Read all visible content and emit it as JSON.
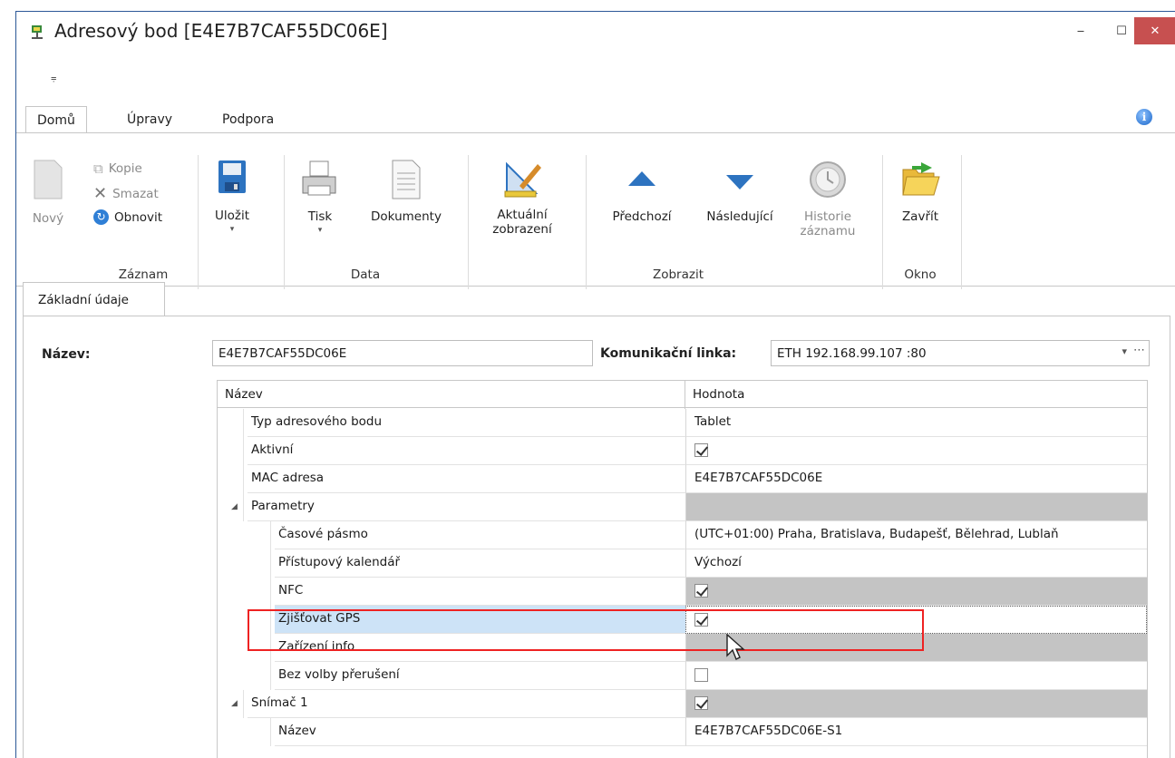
{
  "window": {
    "title": "Adresový bod [E4E7B7CAF55DC06E]",
    "min_glyph": "‒",
    "max_glyph": "☐",
    "close_glyph": "✕"
  },
  "qat": {
    "glyph": "⩦"
  },
  "ribbon_tabs": [
    "Domů",
    "Úpravy",
    "Podpora"
  ],
  "info_glyph": "i",
  "ribbon": {
    "record": {
      "new": "Nový",
      "copy": "Kopie",
      "delete": "Smazat",
      "refresh": "Obnovit",
      "group": "Záznam"
    },
    "data": {
      "save": "Uložit",
      "print": "Tisk",
      "documents": "Dokumenty",
      "group": "Data"
    },
    "view": {
      "current_line1": "Aktuální",
      "current_line2": "zobrazení",
      "prev": "Předchozí",
      "next": "Následující",
      "history_line1": "Historie",
      "history_line2": "záznamu",
      "group": "Zobrazit"
    },
    "window": {
      "close": "Zavřít",
      "group": "Okno"
    }
  },
  "doc_tab": "Základní údaje",
  "form": {
    "name_label": "Název:",
    "name_value": "E4E7B7CAF55DC06E",
    "link_label": "Komunikační linka:",
    "link_value": "ETH 192.168.99.107 :80"
  },
  "grid": {
    "col_name": "Název",
    "col_value": "Hodnota",
    "rows": [
      {
        "name": "Typ adresového bodu",
        "value": "Tablet"
      },
      {
        "name": "Aktivní",
        "check": true
      },
      {
        "name": "MAC adresa",
        "value": "E4E7B7CAF55DC06E"
      },
      {
        "name": "Parametry",
        "group": true
      },
      {
        "name": "Časové pásmo",
        "value": "(UTC+01:00) Praha, Bratislava, Budapešť, Bělehrad, Lublaň"
      },
      {
        "name": "Přístupový kalendář",
        "value": "Výchozí"
      },
      {
        "name": "NFC",
        "check": true
      },
      {
        "name": "Zjišťovat GPS",
        "check": true,
        "selected": true
      },
      {
        "name": "Zařízení info"
      },
      {
        "name": "Bez volby přerušení",
        "check": false
      },
      {
        "name": "Snímač 1",
        "check": true,
        "group": true
      },
      {
        "name": "Název",
        "value": "E4E7B7CAF55DC06E-S1"
      }
    ]
  }
}
